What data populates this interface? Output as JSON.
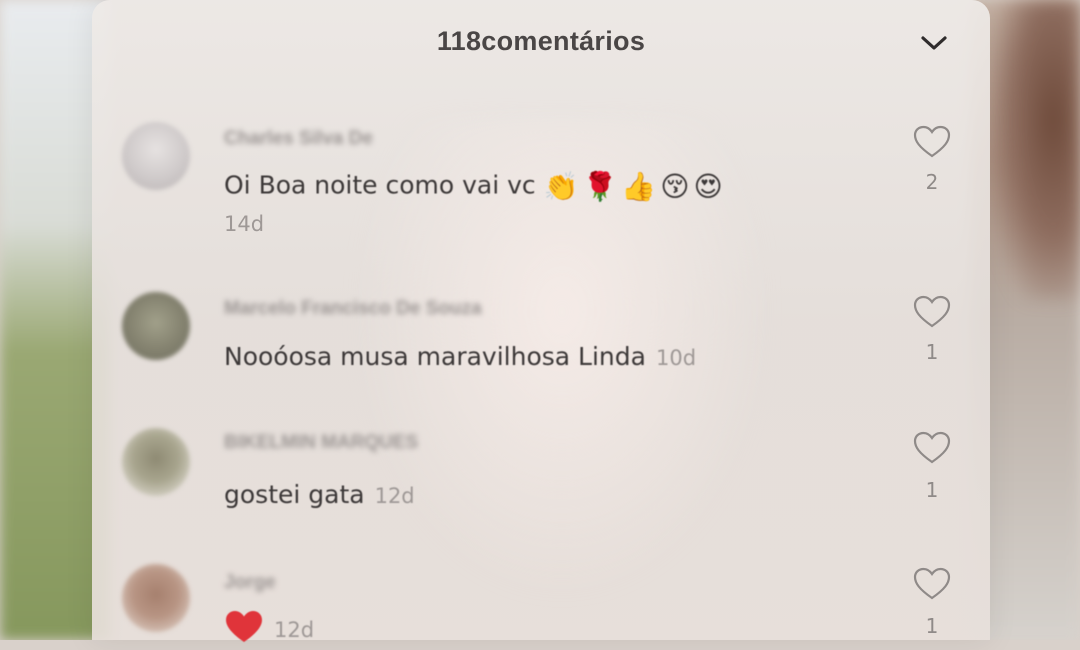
{
  "header": {
    "title": "118comentários"
  },
  "comments": [
    {
      "username": "Charles Silva De",
      "text": "Oi Boa noite como vai vc",
      "emojis": "👏🌹👍😚😍",
      "time": "14d",
      "likes": "2"
    },
    {
      "username": "Marcelo Francisco De Souza",
      "text": "Nooóosa musa maravilhosa Linda",
      "time": "10d",
      "likes": "1"
    },
    {
      "username": "BIKELMIN MARQUES",
      "text": "gostei gata",
      "time": "12d",
      "likes": "1"
    },
    {
      "username": "Jorge",
      "text": "",
      "time": "12d",
      "likes": "1"
    }
  ],
  "colors": {
    "accent_heart": "#e0343a",
    "text_primary": "#3c3838",
    "text_secondary": "#9e9896"
  },
  "icons": {
    "close": "chevron-down-icon",
    "like": "heart-outline-icon",
    "reaction": "red-heart-icon"
  }
}
